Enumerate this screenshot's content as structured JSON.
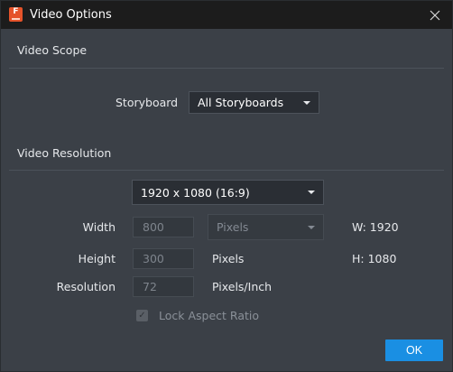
{
  "window": {
    "title": "Video Options",
    "app_icon_letter": "F"
  },
  "scope": {
    "section_title": "Video Scope",
    "storyboard_label": "Storyboard",
    "storyboard_value": "All Storyboards"
  },
  "resolution": {
    "section_title": "Video Resolution",
    "preset_value": "1920 x 1080 (16:9)",
    "width_label": "Width",
    "width_value": "800",
    "height_label": "Height",
    "height_value": "300",
    "resolution_label": "Resolution",
    "resolution_value": "72",
    "unit_select_value": "Pixels",
    "height_unit": "Pixels",
    "resolution_unit": "Pixels/Inch",
    "w_readout": "W: 1920",
    "h_readout": "H: 1080",
    "lock_label": "Lock Aspect Ratio",
    "lock_checked": true
  },
  "footer": {
    "ok_label": "OK"
  },
  "colors": {
    "accent": "#1a8fe3",
    "titlebar": "#1c1c1c",
    "background": "#3b4047",
    "app_icon": "#e5532a"
  }
}
